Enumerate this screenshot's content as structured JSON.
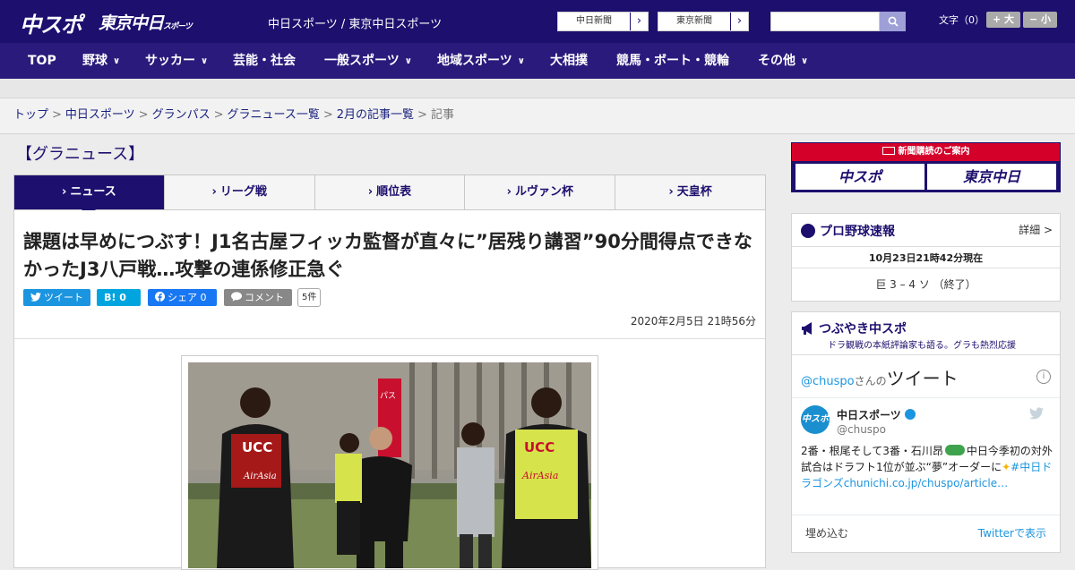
{
  "header": {
    "logo_chuspo": "中スポ",
    "logo_tokyo": "東京中日",
    "logo_tokyo_small": "スポーツ",
    "site_links": "中日スポーツ / 東京中日スポーツ",
    "chunichi_btn": "中日新聞",
    "tokyo_btn": "東京新聞",
    "arrow": "›",
    "search_placeholder": "",
    "font_size_label": "文字（0）",
    "font_larger": "+ 大",
    "font_smaller": "− 小"
  },
  "nav": {
    "items": [
      {
        "label": "TOP"
      },
      {
        "label": "野球"
      },
      {
        "label": "サッカー"
      },
      {
        "label": "芸能・社会"
      },
      {
        "label": "一般スポーツ"
      },
      {
        "label": "地域スポーツ"
      },
      {
        "label": "大相撲"
      },
      {
        "label": "競馬・ボート・競輪"
      },
      {
        "label": "その他"
      }
    ],
    "chevron": "∨"
  },
  "breadcrumb": {
    "items": [
      "トップ",
      "中日スポーツ",
      "グランパス",
      "グラニュース一覧",
      "2月の記事一覧"
    ],
    "current": "記事",
    "sep": ">"
  },
  "section_title": "【グラニュース】",
  "tabs": {
    "items": [
      {
        "label": "ニュース"
      },
      {
        "label": "リーグ戦"
      },
      {
        "label": "順位表"
      },
      {
        "label": "ルヴァン杯"
      },
      {
        "label": "天皇杯"
      }
    ],
    "marker": "›"
  },
  "article": {
    "headline": "課題は早めにつぶす！J1名古屋フィッカ監督が直々に”居残り講習”90分間得点できなかったJ3八戸戦…攻撃の連係修正急ぐ",
    "tweet_btn": "ツイート",
    "hatena_btn": "B! 0",
    "fb_btn": "シェア 0",
    "comment_btn": "コメント",
    "comment_count": "5件",
    "date": "2020年2月5日 21時56分",
    "photo_text_ucc": "UCC",
    "photo_text_airasia": "AirAsia",
    "photo_text_paas": "パス"
  },
  "sidebar": {
    "ad": {
      "banner": "新聞購読のご案内",
      "logo_chuspo": "中スポ",
      "logo_tokyo": "東京中日"
    },
    "baseball": {
      "title": "プロ野球速報",
      "detail": "詳細 >",
      "time": "10月23日21時42分現在",
      "score": "巨 3 – 4 ソ （終了）"
    },
    "tsubuyaki": {
      "title": "つぶやき中スポ",
      "subtitle": "ドラ観戦の本紙評論家も語る。グラも熱烈応援",
      "account": "@chuspo",
      "account_suffix": "さんの",
      "tweets_label": "ツイート",
      "info": "i",
      "user_name": "中日スポーツ",
      "user_handle": "@chuspo",
      "tweet_text_1": "2番・根尾そして3番・石川昂",
      "tweet_text_2": "中日今季初の対外試合はドラフト1位が並ぶ“夢”オーダーに",
      "tweet_link": "#中日ドラゴンズ",
      "tweet_url": "chunichi.co.jp/chuspo/article…",
      "embed": "埋め込む",
      "view_on_twitter": "Twitterで表示"
    }
  },
  "colors": {
    "brand": "#1d0f6e",
    "nav": "#2a1a7c",
    "twitter": "#1b95e0",
    "facebook": "#1877f2",
    "ad_red": "#d4002a"
  }
}
